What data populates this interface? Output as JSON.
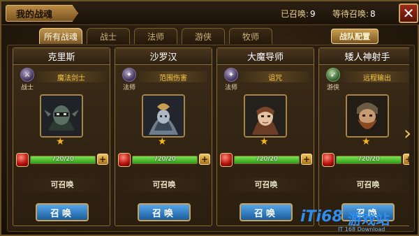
{
  "header": {
    "title": "我的战魂",
    "summoned_label": "已召唤:",
    "summoned_count": "9",
    "pending_label": "等待召唤:",
    "pending_count": "8"
  },
  "tabs": [
    {
      "label": "所有战魂",
      "active": true
    },
    {
      "label": "战士",
      "active": false
    },
    {
      "label": "法师",
      "active": false
    },
    {
      "label": "游侠",
      "active": false
    },
    {
      "label": "牧师",
      "active": false
    }
  ],
  "team_config_label": "战队配置",
  "cards": [
    {
      "name": "克里斯",
      "class_label": "战士",
      "skill": "魔法剑士",
      "stars": "★",
      "progress": "720/20",
      "progress_fraction": 1.0,
      "state": "可召唤",
      "summon_label": "召唤"
    },
    {
      "name": "沙罗汉",
      "class_label": "法师",
      "skill": "范围伤害",
      "stars": "★",
      "progress": "720/20",
      "progress_fraction": 1.0,
      "state": "可召唤",
      "summon_label": "召唤"
    },
    {
      "name": "大魔导师",
      "class_label": "法师",
      "skill": "诅咒",
      "stars": "★",
      "progress": "720/20",
      "progress_fraction": 1.0,
      "state": "可召唤",
      "summon_label": "召唤"
    },
    {
      "name": "矮人神射手",
      "class_label": "游侠",
      "skill": "远程输出",
      "stars": "★",
      "progress": "720/20",
      "progress_fraction": 1.0,
      "state": "可召唤",
      "summon_label": "召唤"
    }
  ],
  "icons": {
    "close": "close-icon",
    "next": "chevron-right-icon",
    "plus": "plus-icon",
    "gem": "red-gem-icon"
  },
  "colors": {
    "gold": "#c9a052",
    "summon_blue": "#2f78c2",
    "progress_green": "#5ac93a",
    "skill_yellow": "#f5c94a"
  },
  "watermark": {
    "logo": "iTi68",
    "site": "游戏站",
    "sub": "IT 168 Download"
  }
}
